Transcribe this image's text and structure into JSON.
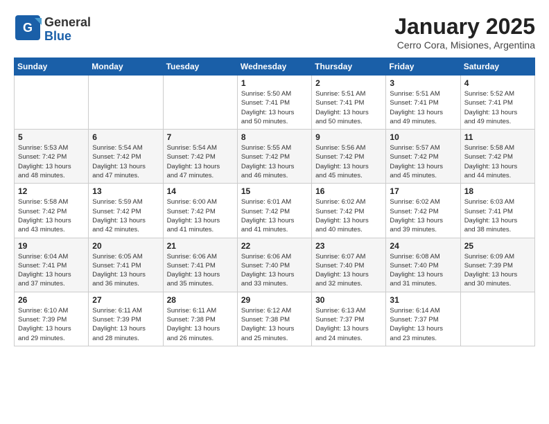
{
  "logo": {
    "general": "General",
    "blue": "Blue"
  },
  "title": "January 2025",
  "subtitle": "Cerro Cora, Misiones, Argentina",
  "days_of_week": [
    "Sunday",
    "Monday",
    "Tuesday",
    "Wednesday",
    "Thursday",
    "Friday",
    "Saturday"
  ],
  "weeks": [
    [
      {
        "day": "",
        "info": ""
      },
      {
        "day": "",
        "info": ""
      },
      {
        "day": "",
        "info": ""
      },
      {
        "day": "1",
        "info": "Sunrise: 5:50 AM\nSunset: 7:41 PM\nDaylight: 13 hours\nand 50 minutes."
      },
      {
        "day": "2",
        "info": "Sunrise: 5:51 AM\nSunset: 7:41 PM\nDaylight: 13 hours\nand 50 minutes."
      },
      {
        "day": "3",
        "info": "Sunrise: 5:51 AM\nSunset: 7:41 PM\nDaylight: 13 hours\nand 49 minutes."
      },
      {
        "day": "4",
        "info": "Sunrise: 5:52 AM\nSunset: 7:41 PM\nDaylight: 13 hours\nand 49 minutes."
      }
    ],
    [
      {
        "day": "5",
        "info": "Sunrise: 5:53 AM\nSunset: 7:42 PM\nDaylight: 13 hours\nand 48 minutes."
      },
      {
        "day": "6",
        "info": "Sunrise: 5:54 AM\nSunset: 7:42 PM\nDaylight: 13 hours\nand 47 minutes."
      },
      {
        "day": "7",
        "info": "Sunrise: 5:54 AM\nSunset: 7:42 PM\nDaylight: 13 hours\nand 47 minutes."
      },
      {
        "day": "8",
        "info": "Sunrise: 5:55 AM\nSunset: 7:42 PM\nDaylight: 13 hours\nand 46 minutes."
      },
      {
        "day": "9",
        "info": "Sunrise: 5:56 AM\nSunset: 7:42 PM\nDaylight: 13 hours\nand 45 minutes."
      },
      {
        "day": "10",
        "info": "Sunrise: 5:57 AM\nSunset: 7:42 PM\nDaylight: 13 hours\nand 45 minutes."
      },
      {
        "day": "11",
        "info": "Sunrise: 5:58 AM\nSunset: 7:42 PM\nDaylight: 13 hours\nand 44 minutes."
      }
    ],
    [
      {
        "day": "12",
        "info": "Sunrise: 5:58 AM\nSunset: 7:42 PM\nDaylight: 13 hours\nand 43 minutes."
      },
      {
        "day": "13",
        "info": "Sunrise: 5:59 AM\nSunset: 7:42 PM\nDaylight: 13 hours\nand 42 minutes."
      },
      {
        "day": "14",
        "info": "Sunrise: 6:00 AM\nSunset: 7:42 PM\nDaylight: 13 hours\nand 41 minutes."
      },
      {
        "day": "15",
        "info": "Sunrise: 6:01 AM\nSunset: 7:42 PM\nDaylight: 13 hours\nand 41 minutes."
      },
      {
        "day": "16",
        "info": "Sunrise: 6:02 AM\nSunset: 7:42 PM\nDaylight: 13 hours\nand 40 minutes."
      },
      {
        "day": "17",
        "info": "Sunrise: 6:02 AM\nSunset: 7:42 PM\nDaylight: 13 hours\nand 39 minutes."
      },
      {
        "day": "18",
        "info": "Sunrise: 6:03 AM\nSunset: 7:41 PM\nDaylight: 13 hours\nand 38 minutes."
      }
    ],
    [
      {
        "day": "19",
        "info": "Sunrise: 6:04 AM\nSunset: 7:41 PM\nDaylight: 13 hours\nand 37 minutes."
      },
      {
        "day": "20",
        "info": "Sunrise: 6:05 AM\nSunset: 7:41 PM\nDaylight: 13 hours\nand 36 minutes."
      },
      {
        "day": "21",
        "info": "Sunrise: 6:06 AM\nSunset: 7:41 PM\nDaylight: 13 hours\nand 35 minutes."
      },
      {
        "day": "22",
        "info": "Sunrise: 6:06 AM\nSunset: 7:40 PM\nDaylight: 13 hours\nand 33 minutes."
      },
      {
        "day": "23",
        "info": "Sunrise: 6:07 AM\nSunset: 7:40 PM\nDaylight: 13 hours\nand 32 minutes."
      },
      {
        "day": "24",
        "info": "Sunrise: 6:08 AM\nSunset: 7:40 PM\nDaylight: 13 hours\nand 31 minutes."
      },
      {
        "day": "25",
        "info": "Sunrise: 6:09 AM\nSunset: 7:39 PM\nDaylight: 13 hours\nand 30 minutes."
      }
    ],
    [
      {
        "day": "26",
        "info": "Sunrise: 6:10 AM\nSunset: 7:39 PM\nDaylight: 13 hours\nand 29 minutes."
      },
      {
        "day": "27",
        "info": "Sunrise: 6:11 AM\nSunset: 7:39 PM\nDaylight: 13 hours\nand 28 minutes."
      },
      {
        "day": "28",
        "info": "Sunrise: 6:11 AM\nSunset: 7:38 PM\nDaylight: 13 hours\nand 26 minutes."
      },
      {
        "day": "29",
        "info": "Sunrise: 6:12 AM\nSunset: 7:38 PM\nDaylight: 13 hours\nand 25 minutes."
      },
      {
        "day": "30",
        "info": "Sunrise: 6:13 AM\nSunset: 7:37 PM\nDaylight: 13 hours\nand 24 minutes."
      },
      {
        "day": "31",
        "info": "Sunrise: 6:14 AM\nSunset: 7:37 PM\nDaylight: 13 hours\nand 23 minutes."
      },
      {
        "day": "",
        "info": ""
      }
    ]
  ]
}
